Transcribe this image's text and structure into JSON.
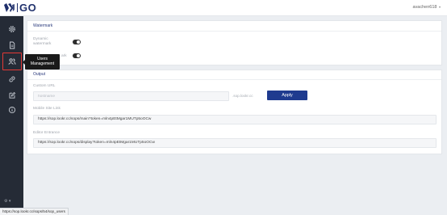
{
  "app": {
    "logo_text": "GO",
    "logo_tag": "II"
  },
  "user": {
    "name": "avachen618",
    "caret": "▾"
  },
  "colors": {
    "brand": "#1e2f6b",
    "sidebar": "#252b36",
    "accent": "#1f3b8f",
    "highlight": "#e53935"
  },
  "sidebar": {
    "items": [
      {
        "icon": "gear-icon"
      },
      {
        "icon": "document-icon"
      },
      {
        "icon": "users-icon",
        "active": true
      },
      {
        "icon": "link-icon"
      },
      {
        "icon": "edit-icon"
      },
      {
        "icon": "info-icon"
      }
    ],
    "bottom_label": "⚙ ▾"
  },
  "tooltip": {
    "line1": "Users",
    "line2": "Management"
  },
  "watermark": {
    "title": "Watermark",
    "dynamic_label_line1": "Dynamic",
    "dynamic_label_line2": "watermark",
    "dynamic_on": true,
    "second_label": "ark",
    "second_on": true
  },
  "output": {
    "title": "Output",
    "custom_url_label": "Custom URL",
    "hostname_placeholder": "hostname",
    "domain_suffix": ".sop.lookr.cc",
    "apply_label": "Apply",
    "mobile_label": "Mobile Site Link",
    "mobile_value": "https://sop.lookr.cc/sops/main?token=mln4pEtMgar1MUTp5oOCw",
    "editor_label": "Editor Entrance",
    "editor_value": "https://sop.lookr.cc/sops/display?token=mln4pEtMgar1MUTp5oOCw"
  },
  "status_url": "https://sop.lookr.cc/sops/54/sop_users"
}
